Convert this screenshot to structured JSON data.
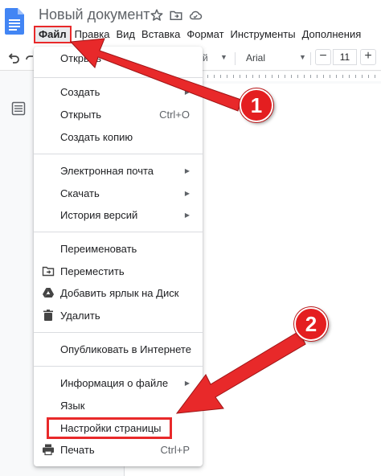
{
  "header": {
    "doc_title": "Новый документ",
    "icons": [
      "star-icon",
      "move-to-folder-icon",
      "cloud-status-icon"
    ]
  },
  "menubar": {
    "items": [
      "Файл",
      "Правка",
      "Вид",
      "Вставка",
      "Формат",
      "Инструменты",
      "Дополнения"
    ]
  },
  "toolbar": {
    "partial_label": "й",
    "font": "Arial",
    "font_size": "11",
    "minus": "−",
    "plus": "+"
  },
  "file_menu": {
    "items": [
      {
        "label": "Открыть",
        "icon": "",
        "submenu": false,
        "shortcut": ""
      },
      {
        "label": "Создать",
        "icon": "",
        "submenu": true,
        "shortcut": ""
      },
      {
        "label": "Открыть",
        "icon": "",
        "submenu": false,
        "shortcut": "Ctrl+O"
      },
      {
        "label": "Создать копию",
        "icon": "",
        "submenu": false,
        "shortcut": ""
      },
      {
        "label": "Электронная почта",
        "icon": "",
        "submenu": true,
        "shortcut": ""
      },
      {
        "label": "Скачать",
        "icon": "",
        "submenu": true,
        "shortcut": ""
      },
      {
        "label": "История версий",
        "icon": "",
        "submenu": true,
        "shortcut": ""
      },
      {
        "label": "Переименовать",
        "icon": "",
        "submenu": false,
        "shortcut": ""
      },
      {
        "label": "Переместить",
        "icon": "move-folder-icon",
        "submenu": false,
        "shortcut": ""
      },
      {
        "label": "Добавить ярлык на Диск",
        "icon": "drive-shortcut-icon",
        "submenu": false,
        "shortcut": ""
      },
      {
        "label": "Удалить",
        "icon": "trash-icon",
        "submenu": false,
        "shortcut": ""
      },
      {
        "label": "Опубликовать в Интернете",
        "icon": "",
        "submenu": false,
        "shortcut": ""
      },
      {
        "label": "Информация о файле",
        "icon": "",
        "submenu": true,
        "shortcut": ""
      },
      {
        "label": "Язык",
        "icon": "",
        "submenu": true,
        "shortcut": ""
      },
      {
        "label": "Настройки страницы",
        "icon": "",
        "submenu": false,
        "shortcut": ""
      },
      {
        "label": "Печать",
        "icon": "print-icon",
        "submenu": false,
        "shortcut": "Ctrl+P"
      }
    ]
  },
  "annotations": {
    "step1": "1",
    "step2": "2",
    "color": "#e41e20"
  },
  "colors": {
    "accent_red": "#e8292a",
    "docs_blue": "#4285f4"
  }
}
